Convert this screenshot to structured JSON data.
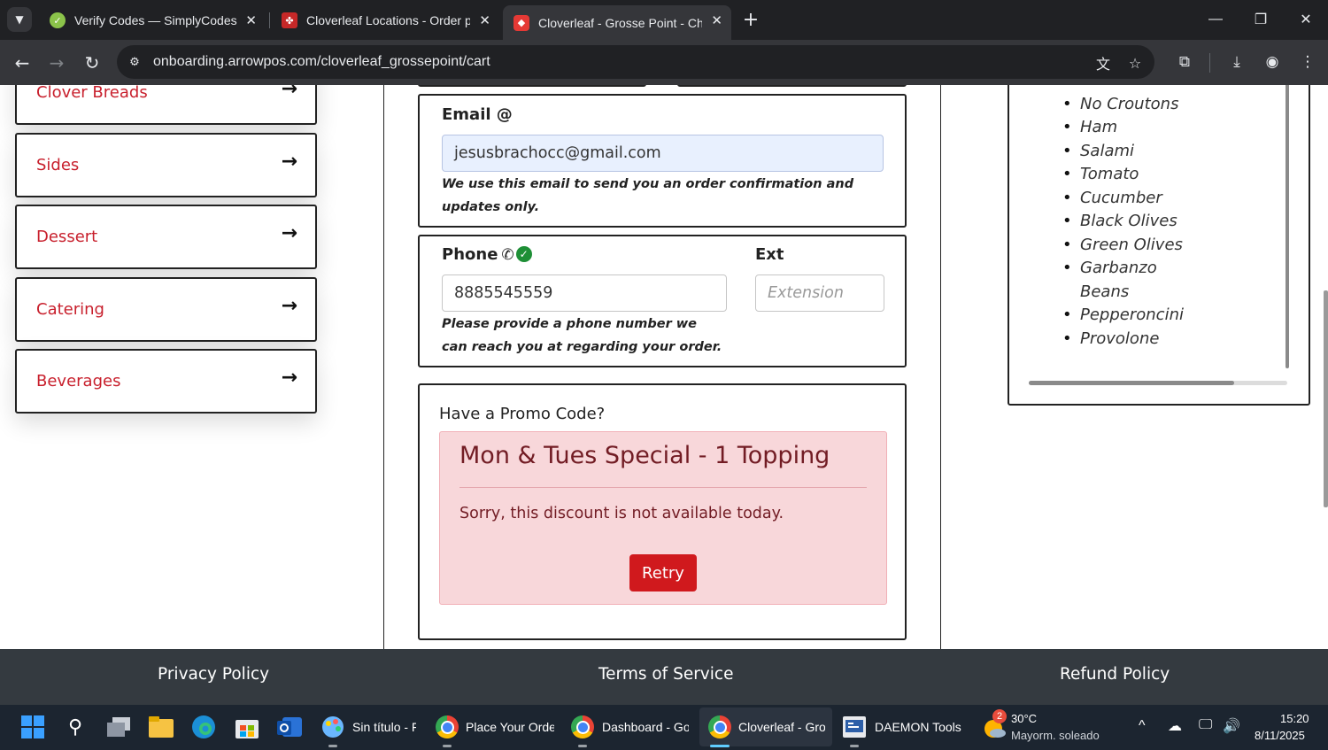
{
  "browser": {
    "tabs": [
      {
        "title": "Verify Codes — SimplyCodes",
        "favicon": "simplycodes-icon",
        "active": false
      },
      {
        "title": "Cloverleaf Locations - Order pizza",
        "favicon": "cloverleaf-icon",
        "active": false
      },
      {
        "title": "Cloverleaf - Grosse Point - Checkout",
        "favicon": "cloverleaf-pizza-icon",
        "active": true
      }
    ],
    "url": "onboarding.arrowpos.com/cloverleaf_grossepoint/cart"
  },
  "sidebar": {
    "categories": [
      {
        "label": "Clover Breads"
      },
      {
        "label": "Sides"
      },
      {
        "label": "Dessert"
      },
      {
        "label": "Catering"
      },
      {
        "label": "Beverages"
      }
    ]
  },
  "form": {
    "email": {
      "label": "Email @",
      "value": "jesusbrachocc@gmail.com",
      "help": "We use this email to send you an order confirmation and updates only."
    },
    "phone": {
      "label": "Phone",
      "value": "8885545559",
      "help": "Please provide a phone number we can reach you at regarding your order."
    },
    "ext": {
      "label": "Ext",
      "placeholder": "Extension"
    },
    "promo": {
      "title": "Have a Promo Code?",
      "alert_heading": "Mon & Tues Special - 1 Topping",
      "alert_message": "Sorry, this discount is not available today.",
      "retry_label": "Retry"
    }
  },
  "toppings": [
    "No Croutons",
    "Ham",
    "Salami",
    "Tomato",
    "Cucumber",
    "Black Olives",
    "Green Olives",
    "Garbanzo Beans",
    "Pepperoncini",
    "Provolone"
  ],
  "footer": {
    "privacy": "Privacy Policy",
    "terms": "Terms of Service",
    "refund": "Refund Policy"
  },
  "taskbar": {
    "apps": [
      {
        "label": "Sin título - F",
        "icon": "paint-icon"
      },
      {
        "label": "Place Your Order",
        "icon": "chrome-icon"
      },
      {
        "label": "Dashboard - Go",
        "icon": "chrome-icon"
      },
      {
        "label": "Cloverleaf - Gros",
        "icon": "chrome-icon"
      },
      {
        "label": "DAEMON Tools L",
        "icon": "daemon-tools-icon"
      }
    ],
    "weather": {
      "badge": "2",
      "temp": "30°C",
      "desc": "Mayorm. soleado"
    },
    "clock": {
      "time": "15:20",
      "date": "8/11/2025"
    }
  },
  "colors": {
    "brand_red": "#c8202d",
    "alert_bg": "#f8d7da",
    "alert_text": "#721c24",
    "retry_button": "#d0191d",
    "footer_bg": "#343a40",
    "email_autofill_bg": "#e8f0fe"
  }
}
